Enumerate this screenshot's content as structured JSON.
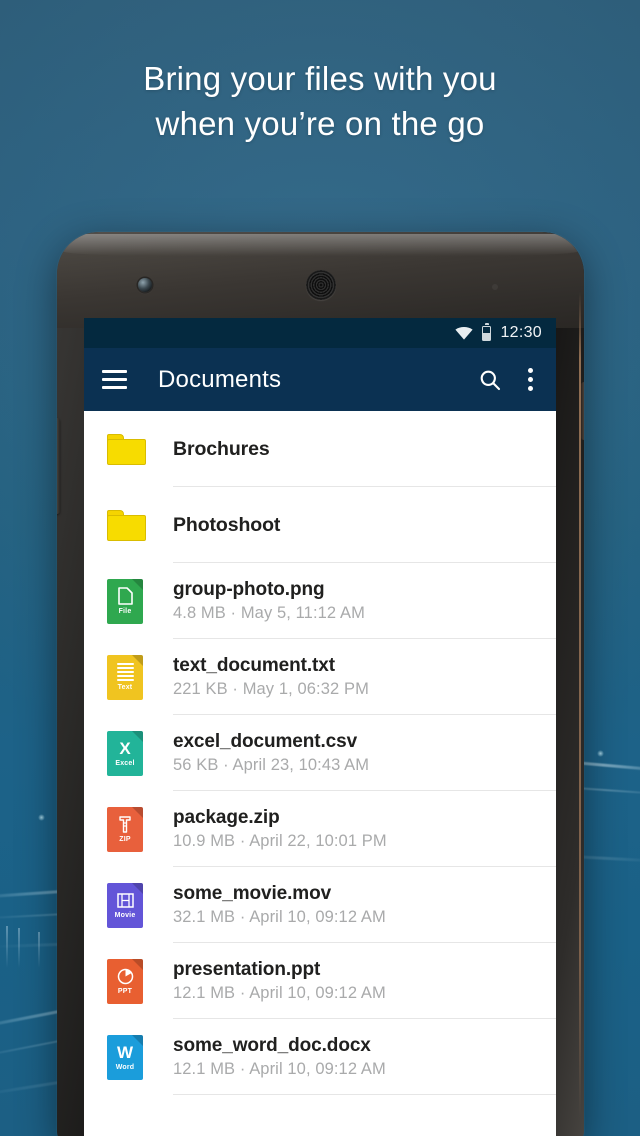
{
  "promo": {
    "headline_line1": "Bring your files with you",
    "headline_line2": "when you’re on the go",
    "background_color": "#2a5e7c",
    "headline_color": "#ffffff"
  },
  "device": {
    "frame_color": "#1a1918",
    "camera_icon": "front-camera",
    "speaker_icon": "earpiece-speaker"
  },
  "statusbar": {
    "wifi_icon": "wifi-icon",
    "battery_icon": "battery-icon",
    "time": "12:30",
    "background_color": "#04293f"
  },
  "appbar": {
    "menu_icon": "hamburger-menu-icon",
    "title": "Documents",
    "search_icon": "search-icon",
    "overflow_icon": "overflow-menu-icon",
    "background_color": "#0b3152"
  },
  "filelist": {
    "items": [
      {
        "type": "folder",
        "name": "Brochures",
        "meta": "",
        "icon": "folder-icon",
        "badge": "",
        "glyph": "",
        "color": "#f7dc00"
      },
      {
        "type": "folder",
        "name": "Photoshoot",
        "meta": "",
        "icon": "folder-icon",
        "badge": "",
        "glyph": "",
        "color": "#f7dc00"
      },
      {
        "type": "file",
        "name": "group-photo.png",
        "meta": "4.8 MB · May 5, 11:12 AM",
        "icon": "file-png-icon",
        "badge": "File",
        "glyph": "page",
        "color": "#2fa84f"
      },
      {
        "type": "file",
        "name": "text_document.txt",
        "meta": "221 KB · May 1, 06:32 PM",
        "icon": "file-txt-icon",
        "badge": "Text",
        "glyph": "lines",
        "color": "#f0c420"
      },
      {
        "type": "file",
        "name": "excel_document.csv",
        "meta": "56 KB · April 23, 10:43 AM",
        "icon": "file-excel-icon",
        "badge": "Excel",
        "glyph": "X",
        "color": "#22b499"
      },
      {
        "type": "file",
        "name": "package.zip",
        "meta": "10.9 MB · April 22, 10:01 PM",
        "icon": "file-zip-icon",
        "badge": "ZIP",
        "glyph": "zipper",
        "color": "#e8603c"
      },
      {
        "type": "file",
        "name": "some_movie.mov",
        "meta": "32.1 MB · April 10, 09:12 AM",
        "icon": "file-movie-icon",
        "badge": "Movie",
        "glyph": "film",
        "color": "#6355d8"
      },
      {
        "type": "file",
        "name": "presentation.ppt",
        "meta": "12.1 MB · April 10, 09:12 AM",
        "icon": "file-ppt-icon",
        "badge": "PPT",
        "glyph": "pie",
        "color": "#e85f31"
      },
      {
        "type": "file",
        "name": "some_word_doc.docx",
        "meta": "12.1 MB · April 10, 09:12 AM",
        "icon": "file-word-icon",
        "badge": "Word",
        "glyph": "W",
        "color": "#1b9ddb"
      }
    ]
  }
}
